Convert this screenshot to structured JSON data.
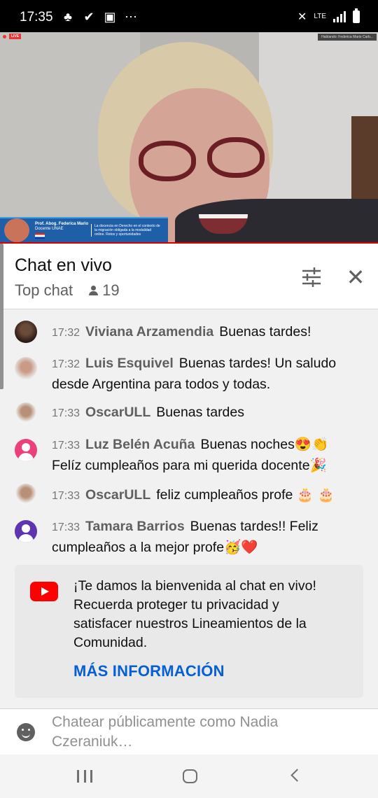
{
  "status_bar": {
    "time": "17:35",
    "left_icons": [
      "notification-icon",
      "check-icon",
      "image-icon",
      "more-icon"
    ],
    "right_icons": [
      "mute-icon",
      "lte-icon",
      "signal-icon",
      "battery-icon"
    ],
    "network": "LTE"
  },
  "video": {
    "live_label": "LIVE",
    "speaking_label": "Hablando: Federica Mario Carb...",
    "presenter_name": "Prof. Abog. Federica Mario",
    "presenter_role": "Docente UNAE",
    "topic": "La docencia en Derecho en el contexto de la migración obligada a la modalidad online. Retos y oportunidades"
  },
  "chat": {
    "title": "Chat en vivo",
    "mode": "Top chat",
    "viewer_count": "19",
    "messages": [
      {
        "time": "17:32",
        "author": "Viviana Arzamendia",
        "text": "Buenas tardes!"
      },
      {
        "time": "17:32",
        "author": "Luis Esquivel",
        "text": "Buenas tardes! Un saludo desde Argentina para todos y todas."
      },
      {
        "time": "17:33",
        "author": "OscarULL",
        "text": "Buenas tardes"
      },
      {
        "time": "17:33",
        "author": "Luz Belén Acuña",
        "text": "Buenas noches😍👏 Felíz cumpleaños para mi querida docente🎉"
      },
      {
        "time": "17:33",
        "author": "OscarULL",
        "text": "feliz cumpleaños profe 🎂 🎂"
      },
      {
        "time": "17:33",
        "author": "Tamara Barrios",
        "text": "Buenas tardes!! Feliz cumpleaños a la mejor profe🥳❤️"
      }
    ],
    "welcome": {
      "text": "¡Te damos la bienvenida al chat en vivo! Recuerda proteger tu privacidad y satisfacer nuestros Lineamientos de la Comunidad.",
      "link": "MÁS INFORMACIÓN"
    },
    "input_placeholder": "Chatear públicamente como Nadia Czeraniuk…"
  },
  "colors": {
    "link_blue": "#065fd4",
    "youtube_red": "#ff0000",
    "avatar_pink": "#ec407a",
    "avatar_purple": "#5e35b1"
  }
}
